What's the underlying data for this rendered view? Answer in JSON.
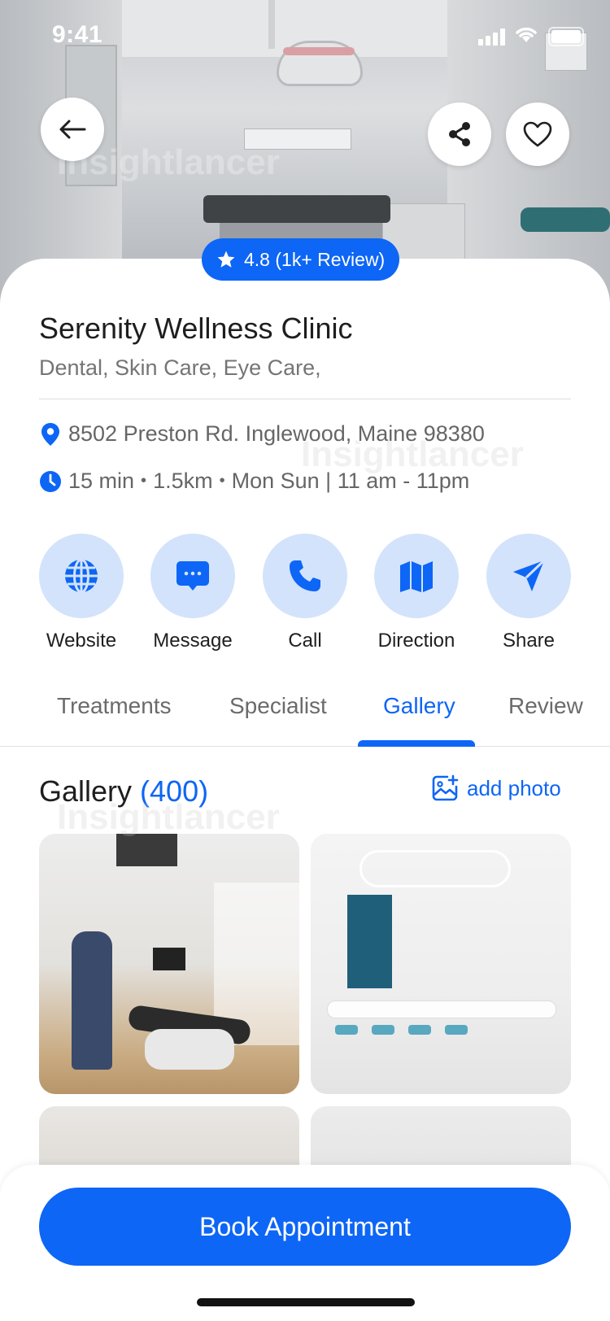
{
  "status_bar": {
    "time": "9:41"
  },
  "hero": {
    "watermark": "Insightlancer"
  },
  "rating": {
    "text": "4.8 (1k+ Review)"
  },
  "clinic": {
    "name": "Serenity Wellness Clinic",
    "categories": "Dental, Skin Care, Eye Care,",
    "address": "8502 Preston Rd. Inglewood, Maine 98380",
    "travel_time": "15 min",
    "distance": "1.5km",
    "hours": "Mon Sun | 11 am - 11pm"
  },
  "actions": [
    {
      "label": "Website",
      "icon": "globe-icon"
    },
    {
      "label": "Message",
      "icon": "chat-icon"
    },
    {
      "label": "Call",
      "icon": "phone-icon"
    },
    {
      "label": "Direction",
      "icon": "map-icon"
    },
    {
      "label": "Share",
      "icon": "send-icon"
    }
  ],
  "tabs": [
    {
      "label": "Treatments"
    },
    {
      "label": "Specialist"
    },
    {
      "label": "Gallery",
      "active": true
    },
    {
      "label": "Review"
    }
  ],
  "gallery": {
    "title": "Gallery",
    "count": "(400)",
    "add_photo_label": "add photo"
  },
  "book_button": {
    "label": "Book Appointment"
  },
  "colors": {
    "primary": "#0D66F5",
    "action_bg": "#D3E3FC",
    "text": "#1E1E1E",
    "muted": "#757575"
  }
}
